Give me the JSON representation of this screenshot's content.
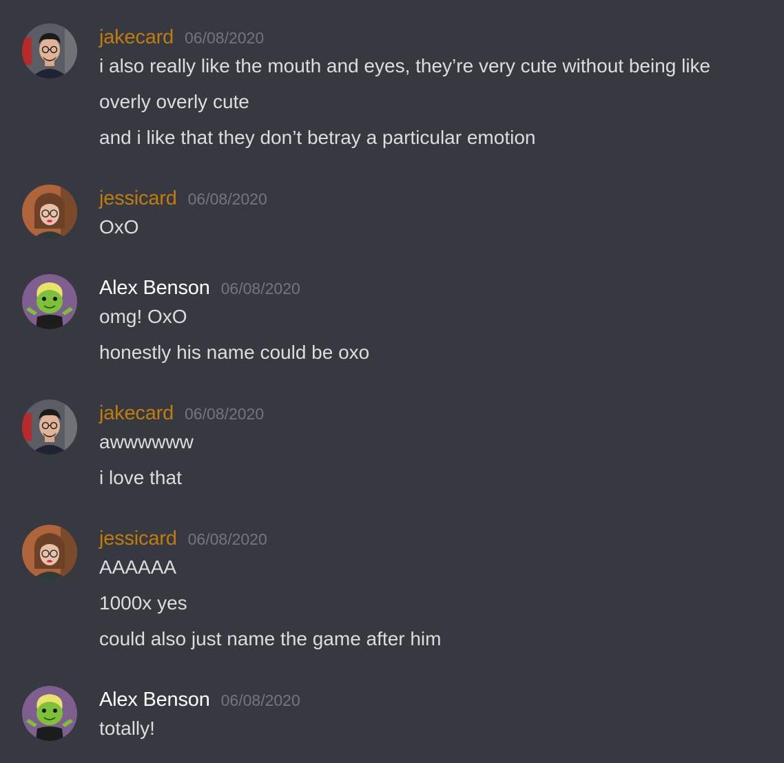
{
  "colors": {
    "background": "#36393f",
    "message_text": "#dcddde",
    "timestamp": "#72767d",
    "role_orange": "#c27c0e",
    "default_name": "#ffffff"
  },
  "messages": [
    {
      "author": "jakecard",
      "author_color": "#c27c0e",
      "avatar_icon": "man-with-glasses-avatar",
      "timestamp": "06/08/2020",
      "lines": [
        "i also really like the mouth and eyes, they’re very cute without being like",
        "overly overly cute",
        "and i like that they don’t betray a particular emotion"
      ]
    },
    {
      "author": "jessicard",
      "author_color": "#c27c0e",
      "avatar_icon": "woman-with-glasses-avatar",
      "timestamp": "06/08/2020",
      "lines": [
        "OxO"
      ]
    },
    {
      "author": "Alex Benson",
      "author_color": "#ffffff",
      "avatar_icon": "green-frog-character-avatar",
      "timestamp": "06/08/2020",
      "lines": [
        "omg! OxO",
        "honestly his name could be oxo"
      ]
    },
    {
      "author": "jakecard",
      "author_color": "#c27c0e",
      "avatar_icon": "man-with-glasses-avatar",
      "timestamp": "06/08/2020",
      "lines": [
        "awwwwww",
        "i love that"
      ]
    },
    {
      "author": "jessicard",
      "author_color": "#c27c0e",
      "avatar_icon": "woman-with-glasses-avatar",
      "timestamp": "06/08/2020",
      "lines": [
        "AAAAAA",
        "1000x yes",
        "could also just name the game after him"
      ]
    },
    {
      "author": "Alex Benson",
      "author_color": "#ffffff",
      "avatar_icon": "green-frog-character-avatar",
      "timestamp": "06/08/2020",
      "lines": [
        "totally!"
      ]
    }
  ]
}
